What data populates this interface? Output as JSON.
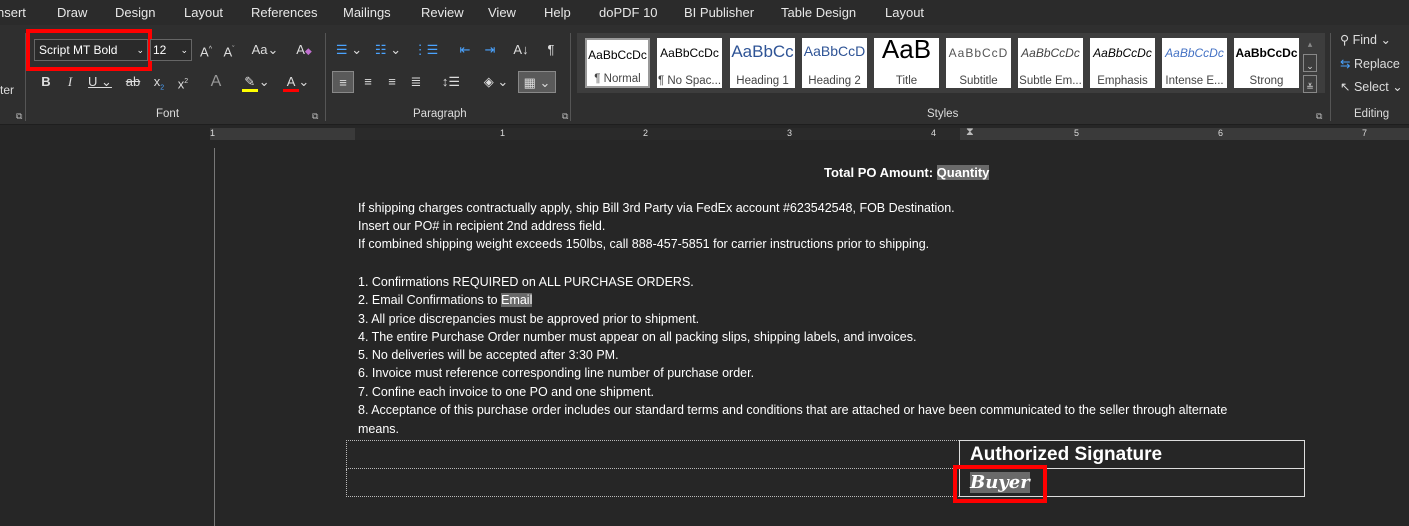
{
  "tabs": [
    "nsert",
    "Draw",
    "Design",
    "Layout",
    "References",
    "Mailings",
    "Review",
    "View",
    "Help",
    "doPDF 10",
    "BI Publisher",
    "Table Design",
    "Layout"
  ],
  "ribbon": {
    "font_name": "Script MT Bold",
    "font_size": "12",
    "left_cut": "ter",
    "font_group": "Font",
    "paragraph_group": "Paragraph",
    "styles_group": "Styles",
    "editing_group": "Editing",
    "styles": [
      {
        "preview": "AaBbCcDc",
        "name": "¶ Normal"
      },
      {
        "preview": "AaBbCcDc",
        "name": "¶ No Spac..."
      },
      {
        "preview": "AaBbCc",
        "name": "Heading 1"
      },
      {
        "preview": "AaBbCcD",
        "name": "Heading 2"
      },
      {
        "preview": "AaB",
        "name": "Title"
      },
      {
        "preview": "AaBbCcD",
        "name": "Subtitle"
      },
      {
        "preview": "AaBbCcDc",
        "name": "Subtle Em..."
      },
      {
        "preview": "AaBbCcDc",
        "name": "Emphasis"
      },
      {
        "preview": "AaBbCcDc",
        "name": "Intense E..."
      },
      {
        "preview": "AaBbCcDc",
        "name": "Strong"
      }
    ],
    "find": "Find",
    "replace": "Replace",
    "select": "Select"
  },
  "ruler": [
    "1",
    "1",
    "2",
    "3",
    "4",
    "5",
    "6",
    "7"
  ],
  "doc": {
    "total_label": "Total PO Amount:",
    "total_value": "Quantity",
    "lines": [
      "If shipping charges contractually apply, ship Bill 3rd Party via FedEx account #623542548, FOB Destination.",
      "Insert our PO# in recipient 2nd address field.",
      "If combined shipping weight exceeds 150lbs, call 888-457-5851 for carrier instructions prior to shipping."
    ],
    "item2_prefix": "2. Email Confirmations to ",
    "item2_field": "Email",
    "items": [
      "1. Confirmations REQUIRED on ALL PURCHASE ORDERS.",
      "3. All price discrepancies must be approved prior to shipment.",
      "4. The entire Purchase Order number must appear on all packing slips, shipping labels, and invoices.",
      "5. No deliveries will be accepted after 3:30 PM.",
      "6. Invoice must reference corresponding line number of purchase order.",
      "7. Confine each invoice to one PO and one shipment.",
      "8. Acceptance of this purchase order includes our standard terms and conditions that are attached or have been communicated to the seller through alternate",
      "means."
    ],
    "sig_header": "Authorized Signature",
    "sig_value": "Buyer"
  }
}
